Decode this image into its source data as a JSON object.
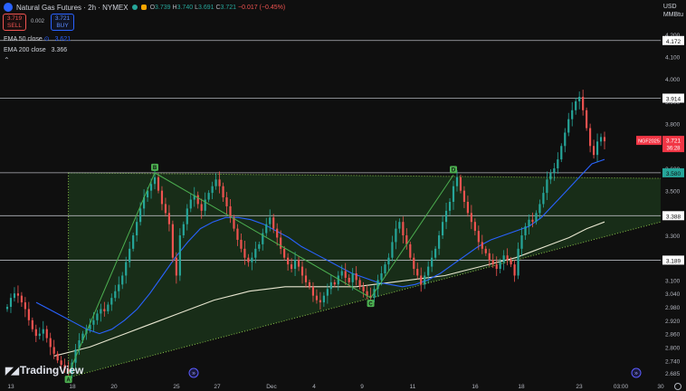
{
  "header": {
    "symbol_title": "Natural Gas Futures · 2h · NYMEX",
    "ohlc": {
      "o_label": "O",
      "o": "3.739",
      "h_label": "H",
      "h": "3.740",
      "l_label": "L",
      "l": "3.691",
      "c_label": "C",
      "c": "3.721",
      "change": "−0.017 (−0.45%)"
    },
    "sell_price": "3.719",
    "sell_label": "SELL",
    "spread": "0.002",
    "buy_price": "3.721",
    "buy_label": "BUY",
    "ema50_label": "EMA 50 close",
    "ema50_value": "3.621",
    "ema200_label": "EMA 200 close",
    "ema200_value": "3.366",
    "currency": "USD",
    "unit": "MMBtu",
    "logo_text": "TradingView",
    "colors": {
      "background": "#0f0f0f",
      "up": "#26a69a",
      "down": "#ef5350",
      "ema50": "#2962ff",
      "ema200": "#e8e6d0",
      "triangle_fill": "#1c3a1c",
      "pattern_line": "#4caf50",
      "price_tag": "#f23645"
    }
  },
  "chart_data": {
    "type": "candlestick",
    "title": "Natural Gas Futures · 2h · NYMEX",
    "x_ticks": [
      "13",
      "18",
      "20",
      "25",
      "27",
      "Dec",
      "4",
      "9",
      "11",
      "16",
      "18",
      "23",
      "03:00",
      "30"
    ],
    "y_ticks": [
      "4.200",
      "4.100",
      "4.000",
      "3.900",
      "3.800",
      "3.700",
      "3.600",
      "3.500",
      "3.400",
      "3.300",
      "3.200",
      "3.100",
      "3.040",
      "2.980",
      "2.920",
      "2.860",
      "2.800",
      "2.740",
      "2.685"
    ],
    "ylim": [
      2.66,
      4.24
    ],
    "horizontal_levels": [
      {
        "value": 4.172,
        "label": "4.172",
        "color": "#ffffff"
      },
      {
        "value": 3.914,
        "label": "3.914",
        "color": "#ffffff"
      },
      {
        "value": 3.58,
        "label": "3.580",
        "color": "#26a69a"
      },
      {
        "value": 3.388,
        "label": "3.388",
        "color": "#ffffff"
      },
      {
        "value": 3.189,
        "label": "3.189",
        "color": "#ffffff"
      }
    ],
    "current_price": {
      "value": 3.721,
      "label": "3.721",
      "countdown": "36:28",
      "ticker": "NGF2025"
    },
    "pattern_points": [
      {
        "label": "A",
        "x_index": 17,
        "value": 2.68
      },
      {
        "label": "B",
        "x_index": 41,
        "value": 3.58
      },
      {
        "label": "C",
        "x_index": 101,
        "value": 3.02
      },
      {
        "label": "D",
        "x_index": 124,
        "value": 3.57
      }
    ],
    "closes": [
      2.98,
      3.02,
      3.04,
      3.03,
      3.0,
      2.97,
      2.92,
      2.88,
      2.85,
      2.86,
      2.88,
      2.84,
      2.8,
      2.77,
      2.74,
      2.72,
      2.7,
      2.68,
      2.73,
      2.79,
      2.83,
      2.86,
      2.88,
      2.9,
      2.92,
      2.95,
      2.97,
      2.96,
      2.99,
      3.02,
      3.05,
      3.08,
      3.12,
      3.18,
      3.24,
      3.3,
      3.36,
      3.42,
      3.47,
      3.5,
      3.53,
      3.56,
      3.5,
      3.44,
      3.4,
      3.35,
      3.2,
      3.12,
      3.3,
      3.35,
      3.42,
      3.46,
      3.48,
      3.44,
      3.41,
      3.46,
      3.49,
      3.52,
      3.55,
      3.52,
      3.47,
      3.43,
      3.38,
      3.33,
      3.28,
      3.24,
      3.2,
      3.18,
      3.2,
      3.24,
      3.26,
      3.31,
      3.35,
      3.38,
      3.33,
      3.29,
      3.24,
      3.2,
      3.17,
      3.15,
      3.19,
      3.16,
      3.12,
      3.09,
      3.07,
      3.03,
      3.01,
      3.0,
      3.03,
      3.06,
      3.09,
      3.08,
      3.12,
      3.14,
      3.11,
      3.09,
      3.13,
      3.1,
      3.07,
      3.05,
      3.03,
      3.02,
      3.06,
      3.1,
      3.13,
      3.17,
      3.2,
      3.27,
      3.33,
      3.36,
      3.3,
      3.26,
      3.2,
      3.15,
      3.12,
      3.08,
      3.12,
      3.16,
      3.2,
      3.24,
      3.3,
      3.36,
      3.41,
      3.45,
      3.52,
      3.56,
      3.5,
      3.45,
      3.4,
      3.36,
      3.32,
      3.27,
      3.24,
      3.22,
      3.19,
      3.17,
      3.15,
      3.18,
      3.21,
      3.19,
      3.17,
      3.12,
      3.24,
      3.3,
      3.34,
      3.37,
      3.36,
      3.4,
      3.44,
      3.49,
      3.55,
      3.58,
      3.6,
      3.64,
      3.7,
      3.76,
      3.82,
      3.86,
      3.9,
      3.92,
      3.86,
      3.78,
      3.7,
      3.66,
      3.72,
      3.74,
      3.721
    ],
    "ema50_approx": [
      3.0,
      2.97,
      2.94,
      2.91,
      2.88,
      2.86,
      2.88,
      2.92,
      2.97,
      3.04,
      3.12,
      3.2,
      3.27,
      3.33,
      3.36,
      3.38,
      3.38,
      3.37,
      3.35,
      3.32,
      3.29,
      3.25,
      3.22,
      3.19,
      3.16,
      3.13,
      3.11,
      3.09,
      3.08,
      3.07,
      3.08,
      3.1,
      3.13,
      3.17,
      3.21,
      3.25,
      3.28,
      3.3,
      3.32,
      3.34,
      3.38,
      3.44,
      3.5,
      3.56,
      3.62,
      3.64
    ],
    "ema200_approx": [
      2.76,
      2.78,
      2.8,
      2.83,
      2.86,
      2.89,
      2.92,
      2.95,
      2.98,
      3.01,
      3.03,
      3.05,
      3.06,
      3.07,
      3.07,
      3.07,
      3.07,
      3.07,
      3.08,
      3.09,
      3.1,
      3.11,
      3.12,
      3.14,
      3.16,
      3.18,
      3.2,
      3.23,
      3.26,
      3.29,
      3.33,
      3.36
    ]
  },
  "axis_labels": {
    "x": [
      "13",
      "18",
      "20",
      "25",
      "27",
      "Dec",
      "4",
      "9",
      "11",
      "16",
      "18",
      "23",
      "03:00",
      "30"
    ],
    "y": [
      "4.200",
      "4.100",
      "4.000",
      "3.900",
      "3.800",
      "3.700",
      "3.600",
      "3.500",
      "3.400",
      "3.300",
      "3.200",
      "3.100",
      "3.040",
      "2.980",
      "2.920",
      "2.860",
      "2.800",
      "2.740",
      "2.685"
    ]
  }
}
